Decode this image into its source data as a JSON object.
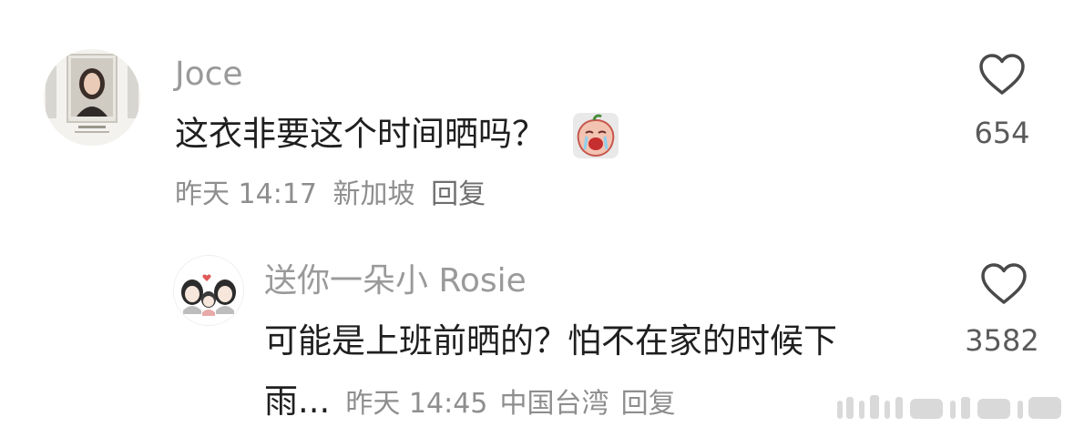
{
  "comments": [
    {
      "name": "Joce",
      "text": "这衣非要这个时间晒吗？",
      "time": "昨天 14:17",
      "location": "新加坡",
      "reply_label": "回复",
      "likes": "654",
      "icon_like": "heart-outline-icon",
      "emoji_name": "crying-peach-emoji"
    },
    {
      "name": "送你一朵小 Rosie",
      "text_line1": "可能是上班前晒的？怕不在家的时候下",
      "text_line2": "雨...",
      "time": "昨天 14:45",
      "location": "中国台湾",
      "reply_label": "回复",
      "likes": "3582",
      "icon_like": "heart-outline-icon"
    }
  ]
}
